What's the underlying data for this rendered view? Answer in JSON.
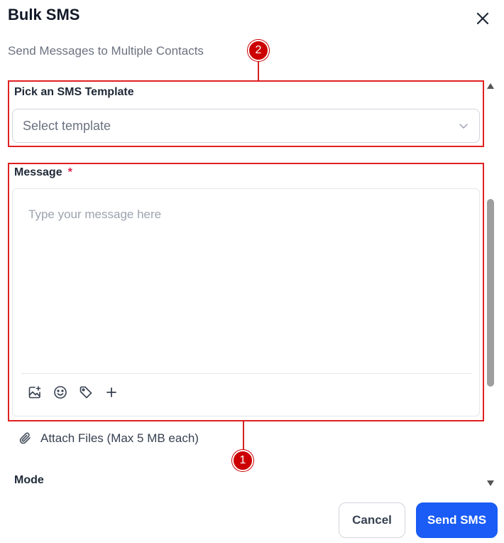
{
  "header": {
    "title": "Bulk SMS",
    "subtitle": "Send Messages to Multiple Contacts"
  },
  "callouts": {
    "first": "1",
    "second": "2"
  },
  "template_field": {
    "label": "Pick an SMS Template",
    "placeholder": "Select template"
  },
  "message_field": {
    "label": "Message",
    "required_marker": "*",
    "placeholder": "Type your message here"
  },
  "toolbar_icons": [
    "image-add-icon",
    "emoji-icon",
    "tag-icon",
    "plus-icon"
  ],
  "attach": {
    "label": "Attach Files (Max 5 MB each)"
  },
  "mode": {
    "label": "Mode"
  },
  "actions": {
    "cancel_label": "Cancel",
    "send_label": "Send SMS"
  },
  "colors": {
    "primary": "#1a5cf5",
    "highlight": "#e02020",
    "required": "#e11d48",
    "callout": "#cc0000"
  }
}
